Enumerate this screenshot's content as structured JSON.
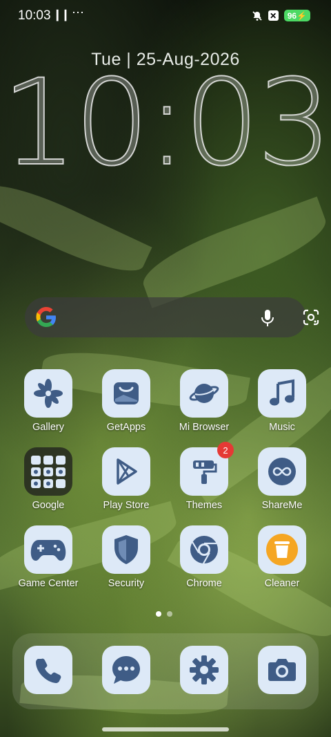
{
  "status": {
    "time": "10:03",
    "signal": "▎▎",
    "more": "⋯",
    "battery": "96"
  },
  "lockscreen": {
    "date": "Tue | 25-Aug-2026",
    "clock": "10:03"
  },
  "search": {
    "accent": "#4285F4"
  },
  "apps": [
    {
      "label": "Gallery"
    },
    {
      "label": "GetApps"
    },
    {
      "label": "Mi Browser"
    },
    {
      "label": "Music"
    },
    {
      "label": "Google"
    },
    {
      "label": "Play Store"
    },
    {
      "label": "Themes",
      "badge": "2"
    },
    {
      "label": "ShareMe"
    },
    {
      "label": "Game Center"
    },
    {
      "label": "Security"
    },
    {
      "label": "Chrome"
    },
    {
      "label": "Cleaner"
    }
  ],
  "dock": [
    "Phone",
    "Messages",
    "Settings",
    "Camera"
  ],
  "colors": {
    "tile": "#dde9f7",
    "icon": "#3f5c86",
    "badge": "#e53935",
    "battery": "#4cd964"
  }
}
